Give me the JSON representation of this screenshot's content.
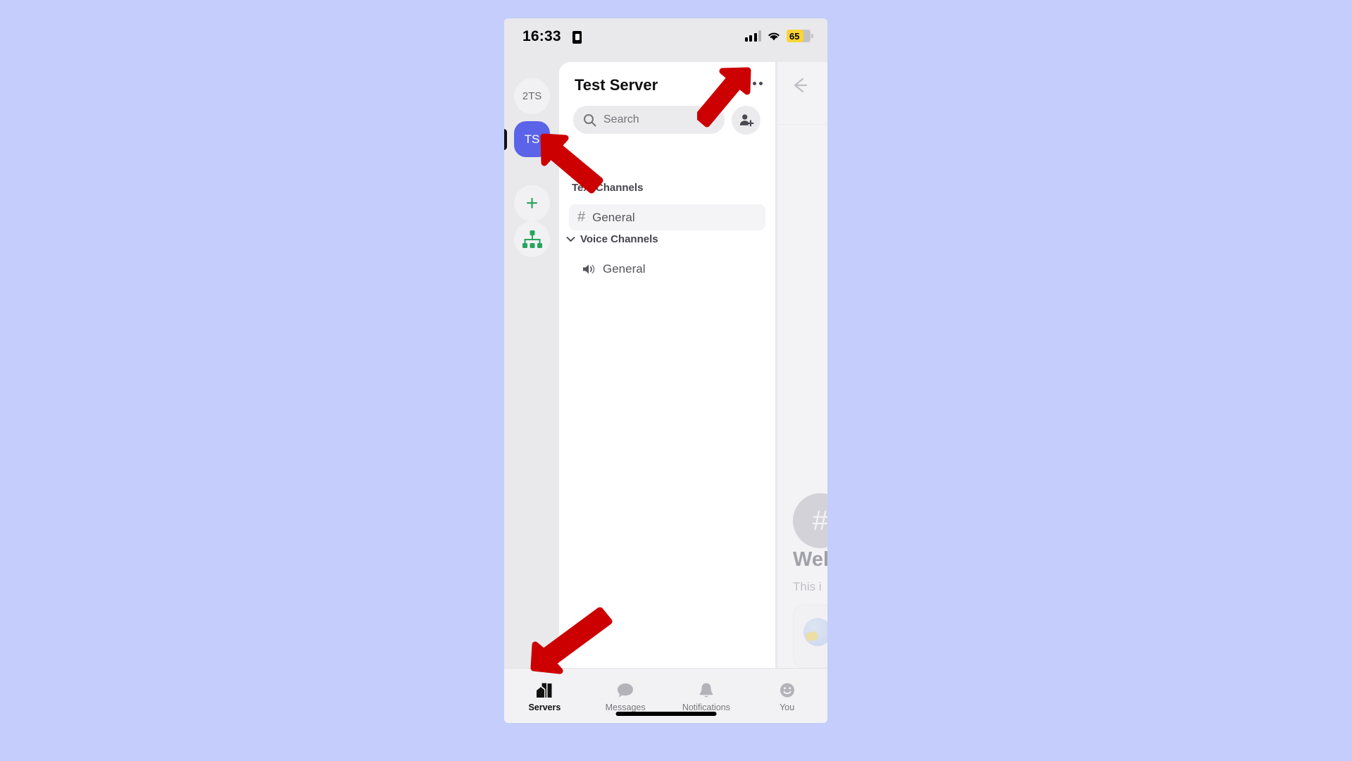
{
  "statusbar": {
    "time": "16:33",
    "lowpower_icon": "low-power-battery-icon",
    "signal_icon": "cellular-signal-icon",
    "wifi_icon": "wifi-icon",
    "battery_level": "65"
  },
  "server_rail": {
    "items": [
      {
        "label": "2TS",
        "name": "server-rail-item-2ts",
        "type": "server"
      },
      {
        "label": "TS",
        "name": "server-rail-item-ts",
        "type": "server",
        "active": true
      },
      {
        "label": "+",
        "name": "add-server-button",
        "type": "action"
      },
      {
        "label": "",
        "name": "discover-servers-button",
        "type": "action",
        "icon": "hierarchy-icon"
      }
    ],
    "accent_active": "#5b63e8",
    "accent_green": "#29a35b"
  },
  "panel": {
    "server_title": "Test Server",
    "overflow_label": "...",
    "search": {
      "placeholder": "Search",
      "icon": "search-icon"
    },
    "add_person_label": "add-person-icon",
    "sections": [
      {
        "label": "Text Channels",
        "name": "text-channels-header"
      },
      {
        "label": "Voice Channels",
        "name": "voice-channels-header"
      }
    ],
    "text_channels": [
      {
        "label": "General",
        "prefix": "#",
        "selected": true
      }
    ],
    "voice_channels": [
      {
        "label": "General",
        "icon": "speaker-icon"
      }
    ]
  },
  "peek_panel": {
    "back_icon": "back-arrow-icon",
    "avatar_glyph": "#",
    "welcome_title": "Wel",
    "welcome_sub": "This i",
    "card_icon": "emoji-globe-icon"
  },
  "tabbar": {
    "tabs": [
      {
        "label": "Servers",
        "icon": "servers-icon",
        "active": true
      },
      {
        "label": "Messages",
        "icon": "message-bubble-icon",
        "active": false
      },
      {
        "label": "Notifications",
        "icon": "bell-icon",
        "active": false
      },
      {
        "label": "You",
        "icon": "smiley-face-icon",
        "active": false
      }
    ]
  },
  "annotations": {
    "arrow_color": "#cc0000",
    "arrows": [
      {
        "name": "arrow-pointing-to-overflow-menu",
        "direction": "up-right"
      },
      {
        "name": "arrow-pointing-to-server-icon",
        "direction": "up-left"
      },
      {
        "name": "arrow-pointing-to-servers-tab",
        "direction": "down-left"
      }
    ]
  },
  "background": {
    "color": "#c4cdfb"
  }
}
